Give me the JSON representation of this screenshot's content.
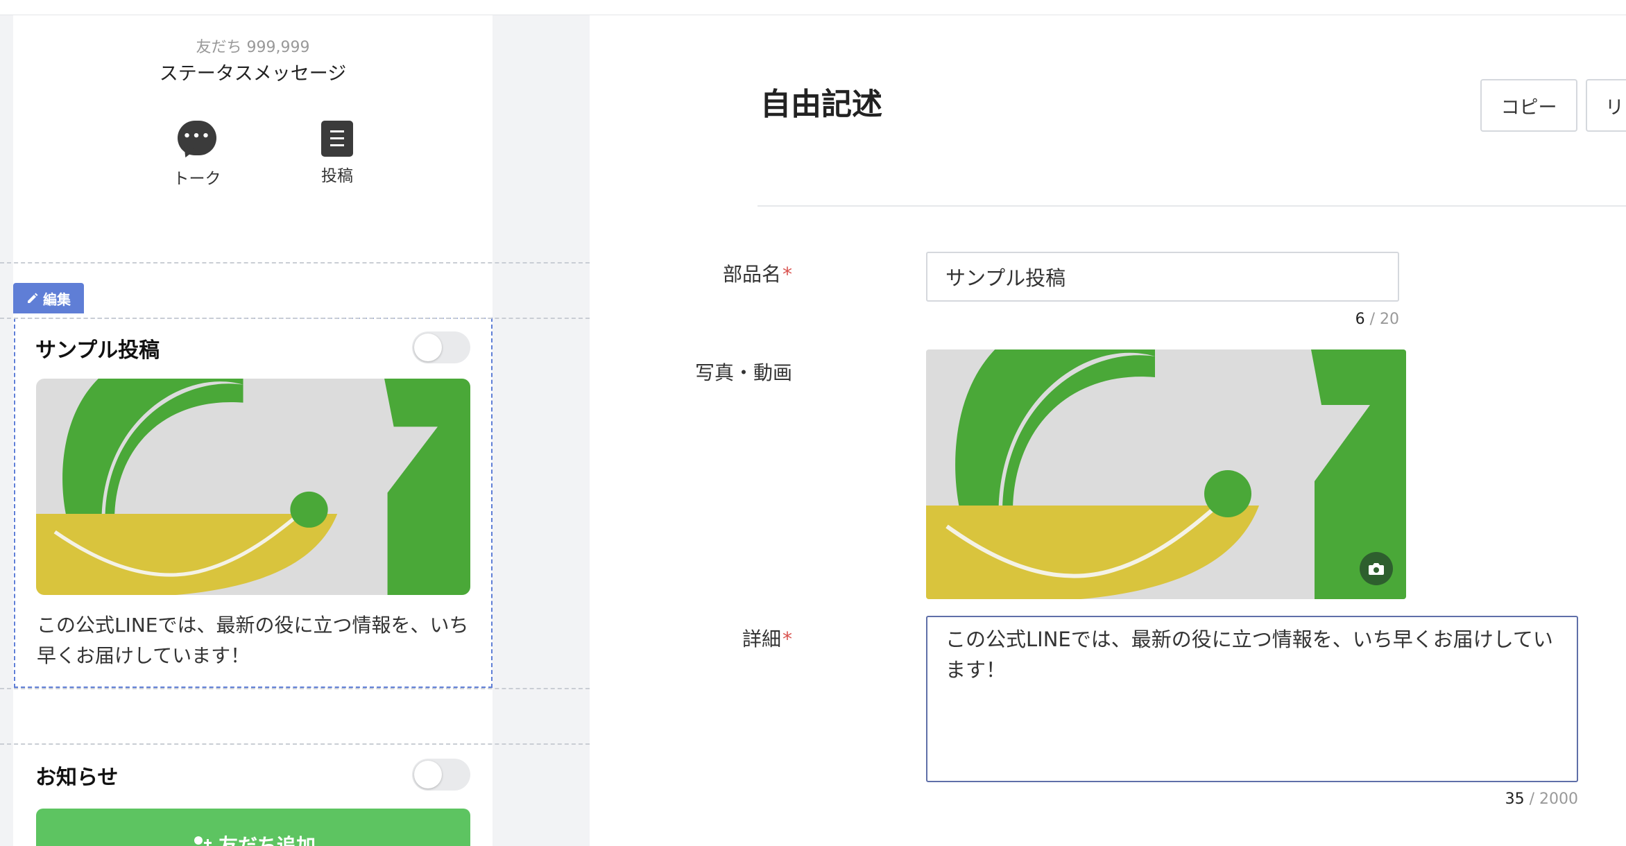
{
  "preview": {
    "friends_text": "友だち 999,999",
    "status_message": "ステータスメッセージ",
    "talk_label": "トーク",
    "post_label": "投稿",
    "edit_tag_label": "編集",
    "card": {
      "title": "サンプル投稿",
      "text": "この公式LINEでは、最新の役に立つ情報を、いち早くお届けしています！"
    },
    "notice_title": "お知らせ",
    "friend_add_label": "友だち追加"
  },
  "editor": {
    "heading": "自由記述",
    "copy_button": "コピー",
    "next_button_partial": "リ",
    "fields": {
      "name_label": "部品名",
      "name_required_mark": "*",
      "name_value": "サンプル投稿",
      "name_count": "6",
      "name_max": "20",
      "media_label": "写真・動画",
      "detail_label": "詳細",
      "detail_required_mark": "*",
      "detail_value": "この公式LINEでは、最新の役に立つ情報を、いち早くお届けしています！",
      "detail_count": "35",
      "detail_max": "2000"
    }
  },
  "colors": {
    "accent_blue": "#5f7ed6",
    "line_green": "#5dc461",
    "required_red": "#d9534f"
  },
  "icons": [
    "talk-icon",
    "post-icon",
    "pencil-icon",
    "camera-icon",
    "add-friend-icon"
  ]
}
